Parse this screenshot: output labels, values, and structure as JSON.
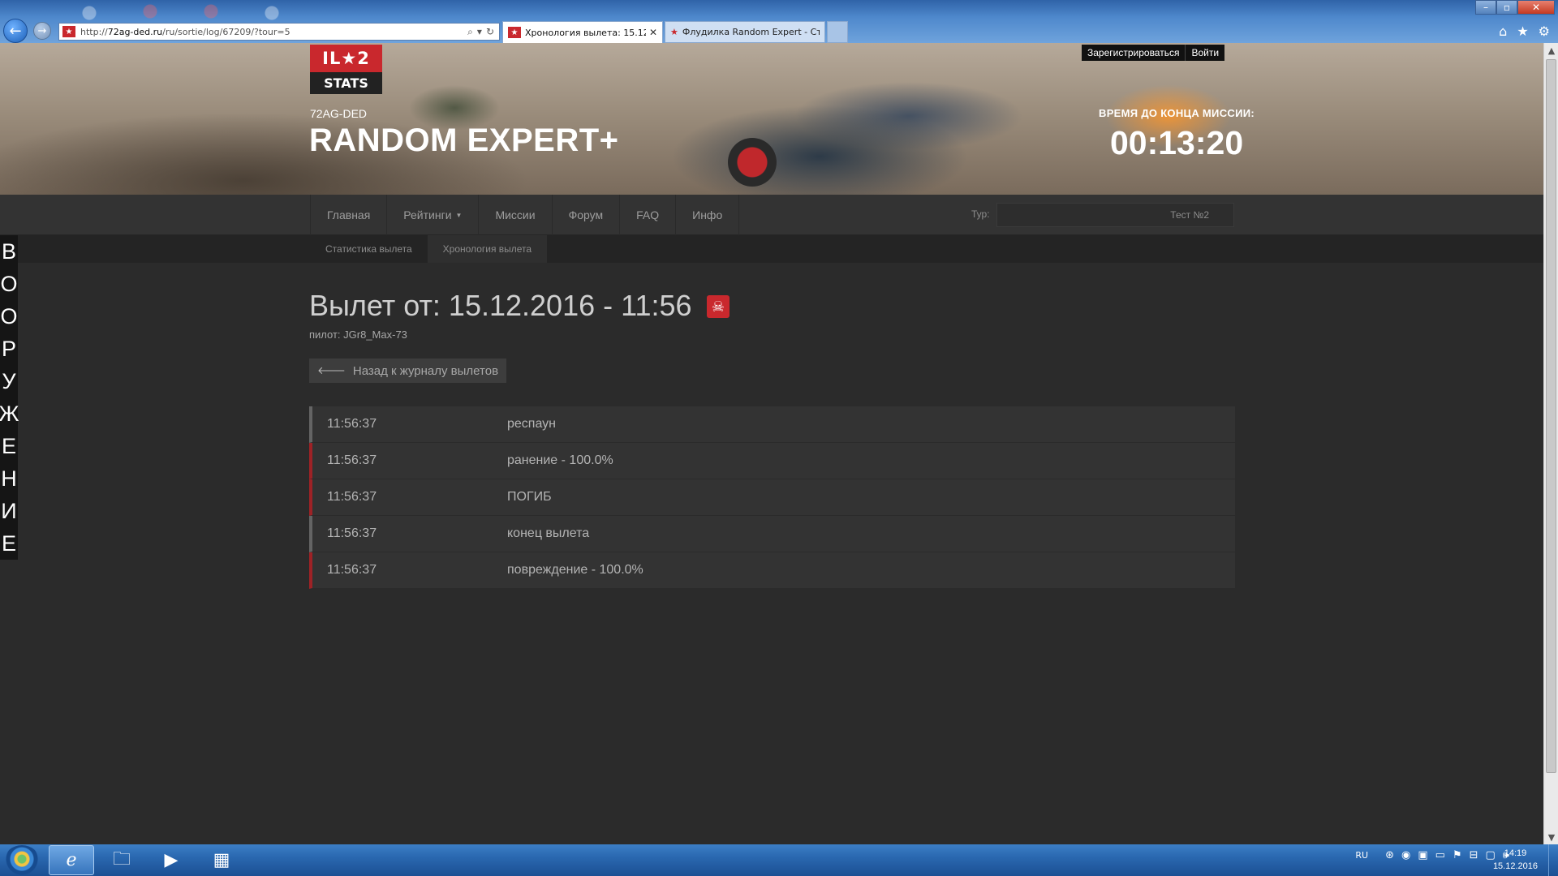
{
  "browser": {
    "address_scheme": "http://",
    "address_host": "72ag-ded.ru",
    "address_path": "/ru/sortie/log/67209/?tour=5",
    "tabs": [
      {
        "label": "Хронология вылета: 15.12....",
        "active": true
      },
      {
        "label": "Флудилка Random Expert - Ст...",
        "active": false
      }
    ]
  },
  "site": {
    "logo_top": "IL★2",
    "logo_bottom": "STATS",
    "server": "72AG-DED",
    "title": "RANDOM EXPERT+",
    "register": "Зарегистрироваться",
    "login": "Войти",
    "timer_label": "ВРЕМЯ ДО КОНЦА МИССИИ:",
    "timer_value": "00:13:20"
  },
  "nav": {
    "items": [
      "Главная",
      "Рейтинги",
      "Миссии",
      "Форум",
      "FAQ",
      "Инфо"
    ],
    "tour_label": "Тур:",
    "tour_value": "Тест №2"
  },
  "subnav": {
    "items": [
      "Статистика вылета",
      "Хронология вылета"
    ],
    "active": "Хронология вылета"
  },
  "side_word": [
    "В",
    "О",
    "О",
    "Р",
    "У",
    "Ж",
    "Е",
    "Н",
    "И",
    "Е"
  ],
  "sortie": {
    "title": "Вылет от: 15.12.2016 - 11:56",
    "pilot": "пилот: JGr8_Max-73",
    "back_label": "Назад к журналу вылетов",
    "events": [
      {
        "time": "11:56:37",
        "text": "респаун",
        "kind": "neutral"
      },
      {
        "time": "11:56:37",
        "text": "ранение - 100.0%",
        "kind": "bad"
      },
      {
        "time": "11:56:37",
        "text": "ПОГИБ",
        "kind": "bad"
      },
      {
        "time": "11:56:37",
        "text": "конец вылета",
        "kind": "neutral"
      },
      {
        "time": "11:56:37",
        "text": "повреждение - 100.0%",
        "kind": "bad"
      }
    ]
  },
  "taskbar": {
    "lang": "RU",
    "time": "14:19",
    "date": "15.12.2016"
  },
  "colors": {
    "accent_red": "#c9282d",
    "page_bg": "#2b2b2b"
  }
}
